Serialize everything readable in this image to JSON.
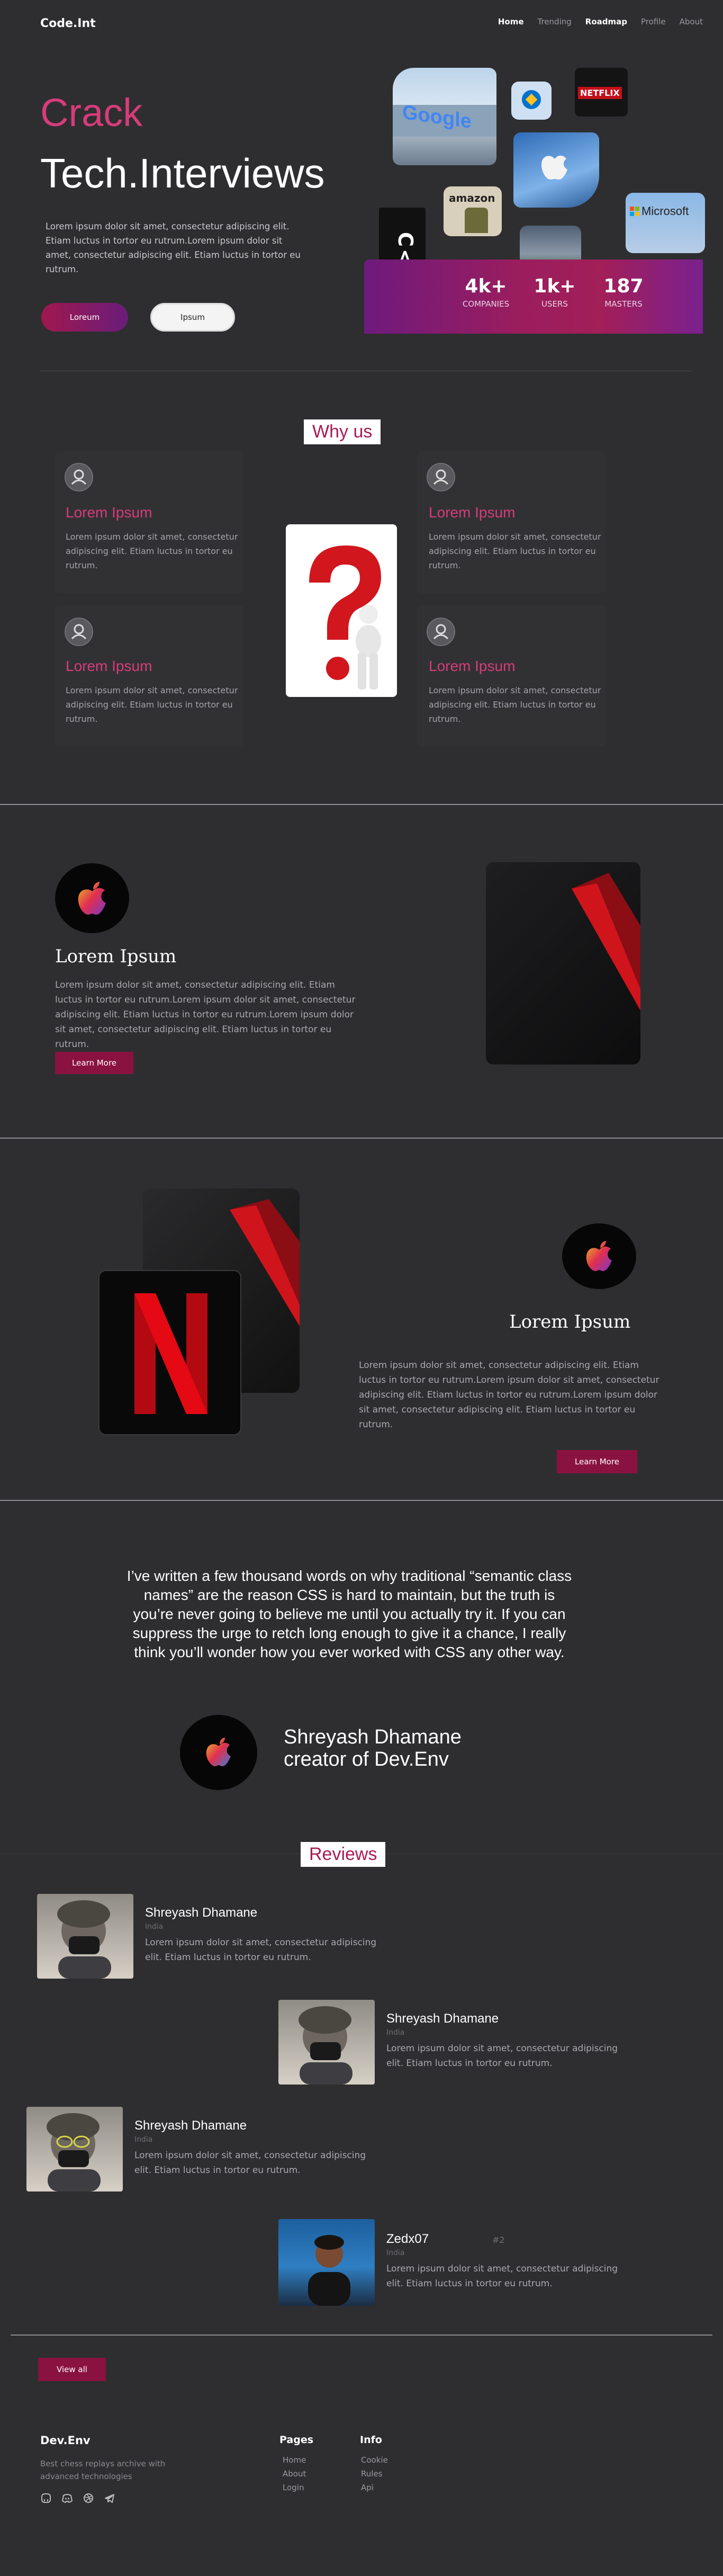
{
  "nav": {
    "brand": "Code.Int",
    "links": [
      "Home",
      "Trending",
      "Roadmap",
      "Profile",
      "About"
    ]
  },
  "hero": {
    "title_accent": "Crack",
    "title_main": "Tech.Interviews",
    "paragraph": "Lorem ipsum dolor sit amet, consectetur adipiscing elit. Etiam luctus in tortor eu rutrum.Lorem ipsum dolor sit amet, consectetur adipiscing elit. Etiam luctus in tortor eu rutrum.",
    "primary_button": "Loreum",
    "secondary_button": "Ipsum",
    "logo_labels": {
      "google": "Google",
      "netflix": "NETFLIX",
      "amazon": "amazon",
      "microsoft": "Microsoft",
      "code": "C<>DE"
    },
    "stats": [
      {
        "value": "4k+",
        "label": "COMPANIES"
      },
      {
        "value": "1k+",
        "label": "USERS"
      },
      {
        "value": "187",
        "label": "MASTERS"
      }
    ]
  },
  "why_us": {
    "title": "Why us",
    "cards": [
      {
        "heading": "Lorem Ipsum",
        "text": "Lorem ipsum dolor sit amet, consectetur adipiscing elit. Etiam luctus in tortor eu rutrum."
      },
      {
        "heading": "Lorem Ipsum",
        "text": "Lorem ipsum dolor sit amet, consectetur adipiscing elit. Etiam luctus in tortor eu rutrum."
      },
      {
        "heading": "Lorem Ipsum",
        "text": "Lorem ipsum dolor sit amet, consectetur adipiscing elit. Etiam luctus in tortor eu rutrum."
      },
      {
        "heading": "Lorem Ipsum",
        "text": "Lorem ipsum dolor sit amet, consectetur adipiscing elit. Etiam luctus in tortor eu rutrum."
      }
    ]
  },
  "feature1": {
    "heading": "Lorem Ipsum",
    "text": "Lorem ipsum dolor sit amet, consectetur adipiscing elit. Etiam luctus in tortor eu rutrum.Lorem ipsum dolor sit amet, consectetur adipiscing elit. Etiam luctus in tortor eu rutrum.Lorem ipsum dolor sit amet, consectetur adipiscing elit. Etiam luctus in tortor eu rutrum.",
    "button": "Learn More"
  },
  "feature2": {
    "heading": "Lorem Ipsum",
    "text": "Lorem ipsum dolor sit amet, consectetur adipiscing elit. Etiam luctus in tortor eu rutrum.Lorem ipsum dolor sit amet, consectetur adipiscing elit. Etiam luctus in tortor eu rutrum.Lorem ipsum dolor sit amet, consectetur adipiscing elit. Etiam luctus in tortor eu rutrum.",
    "button": "Learn More"
  },
  "testimonial": {
    "quote": "I’ve written a few thousand words on why traditional “semantic class names” are the reason CSS is hard to maintain, but the truth is you’re never going to believe me until you actually try it. If you can suppress the urge to retch long enough to give it a chance, I really think you’ll wonder how you ever worked with CSS any other way.",
    "author_name": "Shreyash Dhamane",
    "author_role": "creator of Dev.Env"
  },
  "reviews": {
    "title": "Reviews",
    "items": [
      {
        "name": "Shreyash Dhamane",
        "sub": "India",
        "text": "Lorem ipsum dolor sit amet, consectetur adipiscing elit. Etiam luctus in tortor eu rutrum."
      },
      {
        "name": "Shreyash Dhamane",
        "sub": "India",
        "text": "Lorem ipsum dolor sit amet, consectetur adipiscing elit. Etiam luctus in tortor eu rutrum."
      },
      {
        "name": "Shreyash Dhamane",
        "sub": "India",
        "text": "Lorem ipsum dolor sit amet, consectetur adipiscing elit. Etiam luctus in tortor eu rutrum."
      },
      {
        "name": "Zedx07",
        "sub": "India",
        "rank": "#2",
        "text": "Lorem ipsum dolor sit amet, consectetur adipiscing elit. Etiam luctus in tortor eu rutrum."
      }
    ],
    "view_all": "View all"
  },
  "footer": {
    "brand": "Dev.Env",
    "tagline": "Best chess replays archive with advanced technologies",
    "pages_title": "Pages",
    "pages": [
      "Home",
      "About",
      "Login"
    ],
    "info_title": "Info",
    "info": [
      "Cookie",
      "Rules",
      "Api"
    ],
    "social_icons": [
      "github-icon",
      "discord-icon",
      "dribbble-icon",
      "telegram-icon"
    ]
  },
  "colors": {
    "background": "#2e2e30",
    "accent_pink": "#d63c7a",
    "button_maroon": "#8a1241",
    "title_box_text": "#a81b56"
  }
}
